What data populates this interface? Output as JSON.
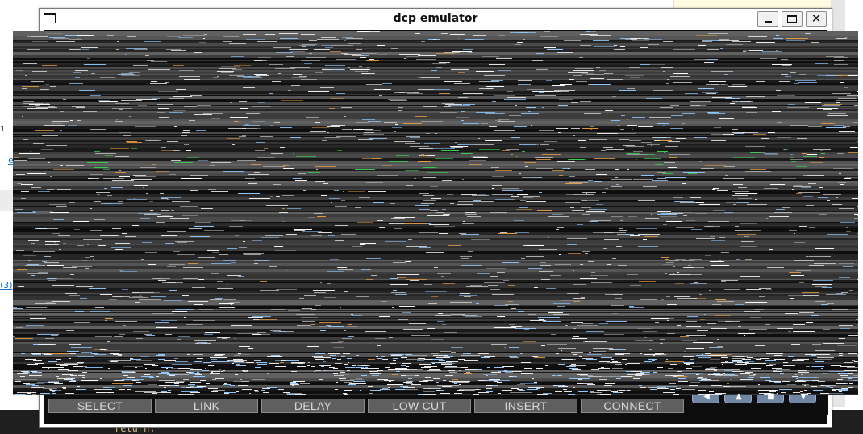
{
  "window": {
    "title": "dcp emulator"
  },
  "background": {
    "code_fragment": "return;",
    "link_fragment": "(3)",
    "text_fragment_a": "1",
    "text_fragment_b": "e"
  },
  "soft_buttons": [
    {
      "label": "SELECT"
    },
    {
      "label": "LINK"
    },
    {
      "label": "DELAY"
    },
    {
      "label": "LOW CUT"
    },
    {
      "label": "INSERT"
    },
    {
      "label": "CONNECT"
    }
  ],
  "nav_buttons": [
    {
      "icon": "chevron-left-icon"
    },
    {
      "icon": "chevron-up-icon"
    },
    {
      "icon": "stop-icon"
    },
    {
      "icon": "chevron-down-icon"
    }
  ],
  "colors": {
    "framebuffer_base": "#404040",
    "noise_white": "#ffffff",
    "noise_blue": "#8fc8ff",
    "noise_orange": "#e89a3c",
    "noise_green": "#33d14a",
    "button_face": "#5f5f5f",
    "button_text": "#d9d9d9",
    "nav_button": "#6f86a4"
  }
}
